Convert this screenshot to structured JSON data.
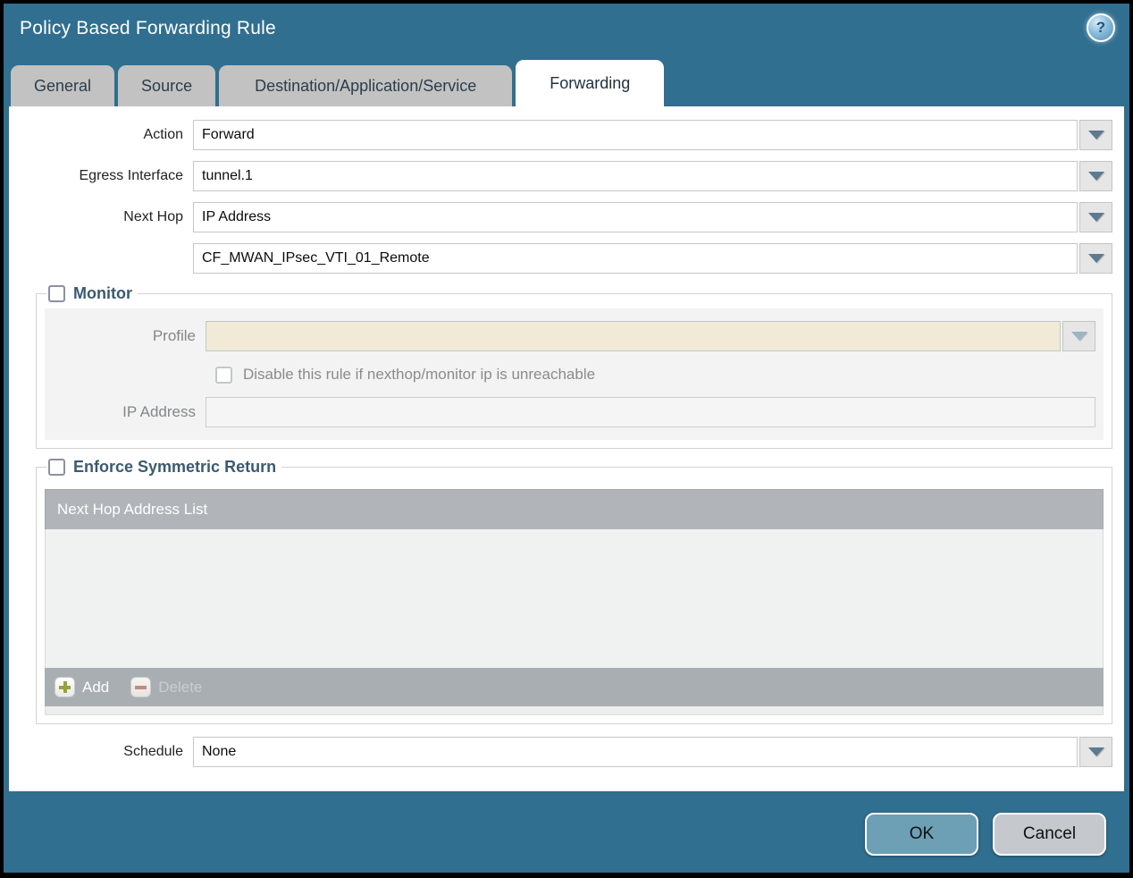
{
  "window": {
    "title": "Policy Based Forwarding Rule"
  },
  "help": {
    "glyph": "?"
  },
  "tabs": [
    {
      "label": "General",
      "active": false
    },
    {
      "label": "Source",
      "active": false
    },
    {
      "label": "Destination/Application/Service",
      "active": false
    },
    {
      "label": "Forwarding",
      "active": true
    }
  ],
  "form": {
    "action": {
      "label": "Action",
      "value": "Forward"
    },
    "egress_interface": {
      "label": "Egress Interface",
      "value": "tunnel.1"
    },
    "next_hop": {
      "label": "Next Hop",
      "value": "IP Address"
    },
    "next_hop_address": {
      "value": "CF_MWAN_IPsec_VTI_01_Remote"
    },
    "schedule": {
      "label": "Schedule",
      "value": "None"
    }
  },
  "monitor": {
    "legend": "Monitor",
    "checked": false,
    "profile": {
      "label": "Profile",
      "value": ""
    },
    "disable_rule": {
      "label": "Disable this rule if nexthop/monitor ip is unreachable",
      "checked": false
    },
    "ip_address": {
      "label": "IP Address",
      "value": ""
    }
  },
  "enforce_symmetric_return": {
    "legend": "Enforce Symmetric Return",
    "checked": false,
    "table": {
      "header": "Next Hop Address List",
      "rows": []
    },
    "add_label": "Add",
    "delete_label": "Delete"
  },
  "footer": {
    "ok_label": "OK",
    "cancel_label": "Cancel"
  },
  "colors": {
    "titlebar_teal": "#306f90",
    "tab_gray": "#c2c2c2",
    "legend_text": "#3c5a6e",
    "table_header_gray": "#b1b5b9",
    "profile_field_cream": "#f0ead6",
    "ok_button": "#6d9fb5",
    "cancel_button": "#c5c9cd",
    "add_plus_green": "#97a23a",
    "delete_minus_red": "#b06a5e"
  }
}
